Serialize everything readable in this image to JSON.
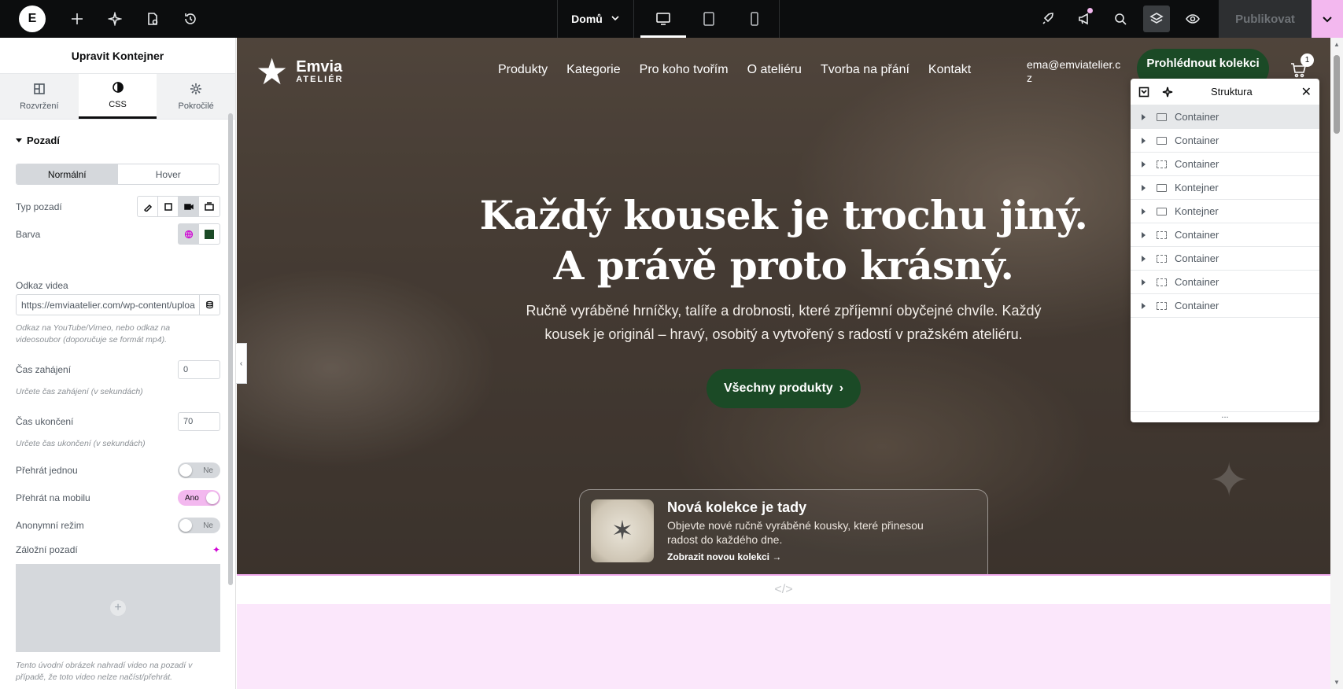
{
  "topbar": {
    "logo_letter": "E",
    "page_selector": "Domů",
    "publish_label": "Publikovat"
  },
  "panel": {
    "title": "Upravit Kontejner",
    "tabs": [
      {
        "label": "Rozvržení",
        "icon": "layout-icon"
      },
      {
        "label": "CSS",
        "icon": "style-icon"
      },
      {
        "label": "Pokročilé",
        "icon": "gear-icon"
      }
    ],
    "section": "Pozadí",
    "states": [
      "Normální",
      "Hover"
    ],
    "bg_type_label": "Typ pozadí",
    "color_label": "Barva",
    "color_value": "#1b4a26",
    "video_link_label": "Odkaz videa",
    "video_link_value": "https://emviaatelier.com/wp-content/uploa",
    "video_help": "Odkaz na YouTube/Vimeo, nebo odkaz na videosoubor (doporučuje se formát mp4).",
    "start_label": "Čas zahájení",
    "start_value": "0",
    "start_help": "Určete čas zahájení (v sekundách)",
    "end_label": "Čas ukončení",
    "end_value": "70",
    "end_help": "Určete čas ukončení (v sekundách)",
    "play_once_label": "Přehrát jednou",
    "play_once_value": "Ne",
    "play_mobile_label": "Přehrát na mobilu",
    "play_mobile_value": "Ano",
    "anon_label": "Anonymní režim",
    "anon_value": "Ne",
    "fallback_label": "Záložní pozadí",
    "fallback_help": "Tento úvodní obrázek nahradí video na pozadí v případě, že toto video nelze načíst/přehrát."
  },
  "site": {
    "logo_name": "Emvia",
    "logo_sub": "ATELIÉR",
    "nav": [
      "Produkty",
      "Kategorie",
      "Pro koho tvořím",
      "O ateliéru",
      "Tvorba na přání",
      "Kontakt"
    ],
    "email": "ema@emviatelier.cz",
    "collection_button": "Prohlédnout kolekci",
    "cart_count": "1",
    "headline_1": "Každý kousek je trochu jiný.",
    "headline_2": "A právě proto krásný.",
    "subline_1": "Ručně vyráběné hrníčky, talíře a drobnosti, které zpříjemní obyčejné chvíle. Každý",
    "subline_2": "kousek je originál – hravý, osobitý a vytvořený s radostí v pražském ateliéru.",
    "products_button": "Všechny produkty",
    "promo_title": "Nová kolekce je tady",
    "promo_text": "Objevte nové ručně vyráběné kousky, které přinesou radost do každého dne.",
    "promo_link": "Zobrazit novou kolekci",
    "brand_green": "#1b4a26",
    "accent_pink": "#f3b8ef"
  },
  "structure": {
    "title": "Struktura",
    "items": [
      "Container",
      "Container",
      "Container",
      "Kontejner",
      "Kontejner",
      "Container",
      "Container",
      "Container",
      "Container"
    ],
    "more": "..."
  }
}
